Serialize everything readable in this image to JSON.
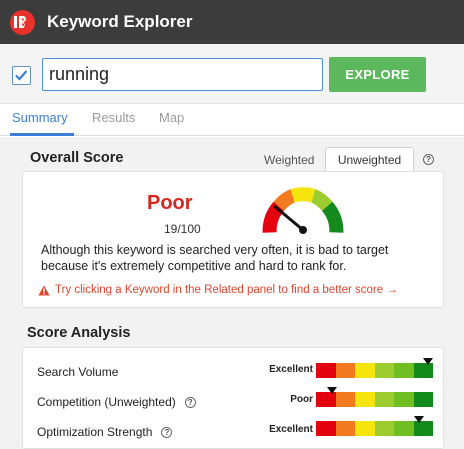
{
  "app": {
    "title": "Keyword Explorer",
    "logo_icon": "tubebuddy-logo"
  },
  "search": {
    "value": "running",
    "checked": true,
    "button_label": "EXPLORE"
  },
  "tabs": [
    {
      "label": "Summary",
      "active": true
    },
    {
      "label": "Results",
      "active": false
    },
    {
      "label": "Map",
      "active": false
    }
  ],
  "overall": {
    "title": "Overall Score",
    "weighted_label": "Weighted",
    "unweighted_label": "Unweighted",
    "selected_view": "Unweighted",
    "help_glyph": "?",
    "score_label": "Poor",
    "score_value": "19/100",
    "score_number": 19,
    "description": "Although this keyword is searched very often, it is bad to target because it's extremely competitive and hard to rank for.",
    "warning": "Try clicking a Keyword in the Related panel to find a better score →"
  },
  "analysis": {
    "title": "Score Analysis",
    "scale_colors": [
      "#e3000f",
      "#f47a1f",
      "#f5e50d",
      "#9ccc2d",
      "#71be22",
      "#138a1b"
    ],
    "metrics": [
      {
        "label": "Search Volume",
        "rating": "Excellent",
        "level": 1.0,
        "has_help": false
      },
      {
        "label": "Competition (Unweighted)",
        "rating": "Poor",
        "level": 0.1,
        "has_help": true
      },
      {
        "label": "Optimization Strength",
        "rating": "Excellent",
        "level": 0.92,
        "has_help": true
      }
    ]
  },
  "colors": {
    "accent": "#3a7fd5",
    "explore": "#5cb85c",
    "poor": "#d7261b",
    "warning": "#e0442c"
  }
}
